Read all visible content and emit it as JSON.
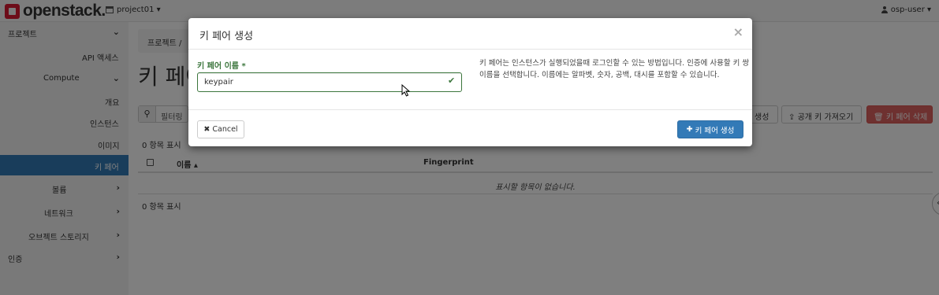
{
  "navbar": {
    "brand": "openstack.",
    "project": "project01 ▾",
    "user": "osp-user ▾"
  },
  "sidebar": {
    "items": [
      {
        "label": "프로젝트",
        "chevron": "⌄"
      },
      {
        "label": "API 액세스"
      },
      {
        "label": "Compute",
        "chevron": "⌄"
      },
      {
        "label": "개요"
      },
      {
        "label": "인스턴스"
      },
      {
        "label": "이미지"
      },
      {
        "label": "키 페어"
      },
      {
        "label": "볼륨",
        "chevron": "›"
      },
      {
        "label": "네트워크",
        "chevron": "›"
      },
      {
        "label": "오브젝트 스토리지",
        "chevron": "›"
      },
      {
        "label": "인증",
        "chevron": "›"
      }
    ]
  },
  "main": {
    "breadcrumb": "프로젝트 /",
    "title": "키 페어",
    "filter_label": "필터링",
    "create_button": "생성",
    "import_button": "공개 키 가져오기",
    "delete_button": "키 페어 삭제",
    "count_top": "0 항목 표시",
    "columns": {
      "name": "이름 ▴",
      "fingerprint": "Fingerprint"
    },
    "empty_message": "표시할 항목이 없습니다.",
    "count_bottom": "0 항목 표시"
  },
  "modal": {
    "title": "키 페어 생성",
    "close": "×",
    "field_label": "키 페어 이름 *",
    "field_value": "keypair",
    "help_text": "키 페어는 인스턴스가 실행되었을때 로그인할 수 있는 방법입니다. 인증에 사용할 키 쌍 이름을 선택합니다. 이름에는 알파벳, 숫자, 공백, 대시를 포함할 수 있습니다.",
    "cancel_label": "Cancel",
    "submit_label": "키 페어 생성"
  },
  "colors": {
    "primary": "#337ab7",
    "success": "#3c763d",
    "danger": "#d9534f",
    "brand": "#da1a32"
  }
}
